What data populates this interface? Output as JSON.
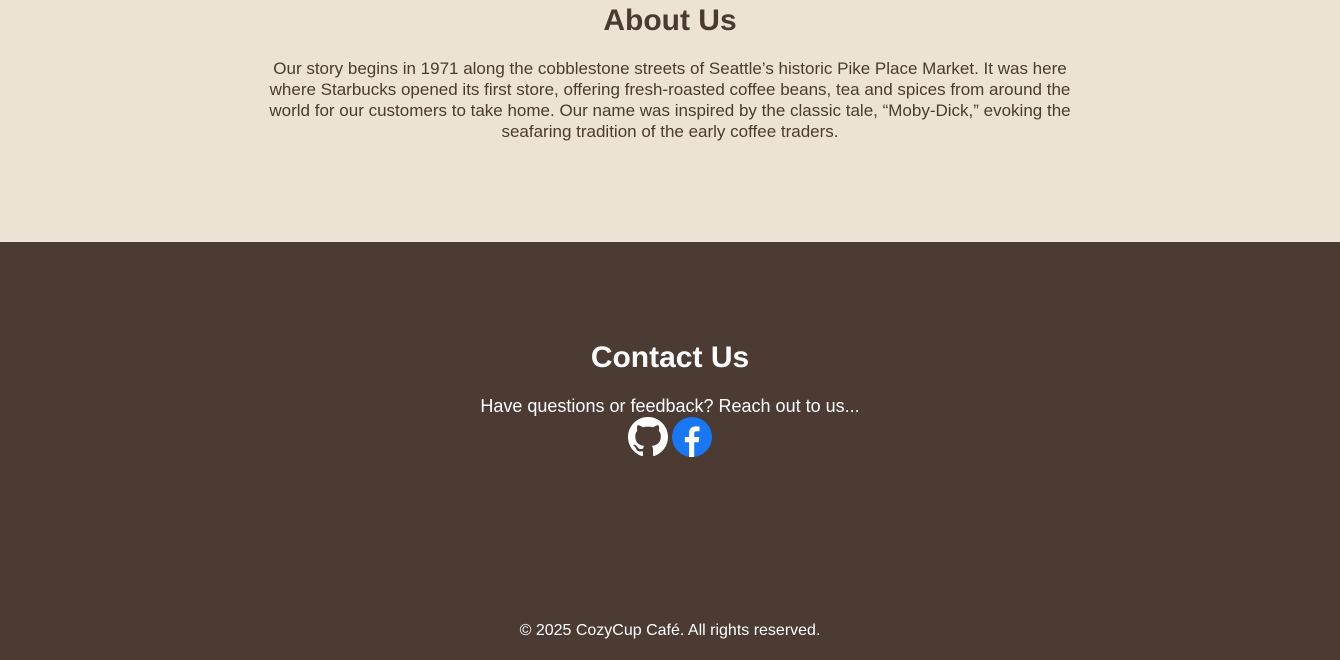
{
  "about": {
    "title": "About Us",
    "body": "Our story begins in 1971 along the cobblestone streets of Seattle’s historic Pike Place Market. It was here where Starbucks opened its first store, offering fresh-roasted coffee beans, tea and spices from around the world for our customers to take home. Our name was inspired by the classic tale, “Moby-Dick,” evoking the seafaring tradition of the early coffee traders."
  },
  "contact": {
    "title": "Contact Us",
    "lead": "Have questions or feedback? Reach out to us...",
    "socials": [
      {
        "icon": "github-icon",
        "color": "#ffffff"
      },
      {
        "icon": "facebook-icon",
        "color": "#1877f2"
      }
    ]
  },
  "footer": {
    "copyright": "© 2025 CozyCup Café. All rights reserved."
  },
  "colors": {
    "about_bg": "#ede3d5",
    "contact_bg": "#4b3b32",
    "text_dark": "#4b3a31"
  }
}
